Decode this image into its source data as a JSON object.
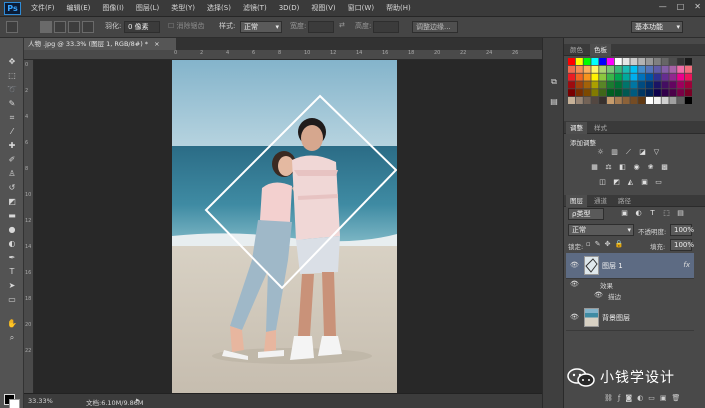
{
  "menubar": {
    "logo": "Ps",
    "items": [
      "文件(F)",
      "编辑(E)",
      "图像(I)",
      "图层(L)",
      "类型(Y)",
      "选择(S)",
      "滤镜(T)",
      "3D(D)",
      "视图(V)",
      "窗口(W)",
      "帮助(H)"
    ],
    "controls": [
      "—",
      "□",
      "✕"
    ]
  },
  "options": {
    "feather_label": "羽化:",
    "feather_value": "0 像素",
    "antialias_label": "消除锯齿",
    "style_label": "样式:",
    "style_value": "正常",
    "width_label": "宽度:",
    "height_label": "高度:",
    "refine_edge": "调整边缘...",
    "workspace": "基本功能"
  },
  "document": {
    "tab_title": "人物 .jpg @ 33.3% (图层 1, RGB/8#) *",
    "close": "×",
    "zoom": "33.33%",
    "doc_size": "文档:6.10M/9.86M"
  },
  "rulers": {
    "top_ticks": [
      "0",
      "2",
      "4",
      "6",
      "8",
      "10",
      "12",
      "14",
      "16",
      "18",
      "20",
      "22",
      "24",
      "26",
      "28",
      "30"
    ],
    "left_ticks": [
      "0",
      "2",
      "4",
      "6",
      "8",
      "10",
      "12",
      "14",
      "16",
      "18",
      "20",
      "22"
    ]
  },
  "swatches_panel": {
    "tabs": [
      "颜色",
      "色板"
    ],
    "active_tab": "色板"
  },
  "adjustments_panel": {
    "tabs": [
      "调整",
      "样式"
    ],
    "heading": "添加调整"
  },
  "layers_panel": {
    "tabs": [
      "图层",
      "通道",
      "路径"
    ],
    "filter_kind": "ρ类型",
    "blend_mode": "正常",
    "opacity_label": "不透明度:",
    "opacity_value": "100%",
    "lock_label": "锁定:",
    "fill_label": "填充:",
    "fill_value": "100%",
    "layers": [
      {
        "name": "图层 1",
        "fx": "fx",
        "selected": true
      },
      {
        "name": "背景图层",
        "selected": false
      }
    ],
    "effects_label": "效果",
    "stroke_label": "描边"
  },
  "watermark": {
    "text": "小钱学设计"
  },
  "colors": {
    "accent_selected_layer": "#5d6b83",
    "ps_blue": "#39a5ff",
    "selection_stroke": "#ffffff"
  }
}
